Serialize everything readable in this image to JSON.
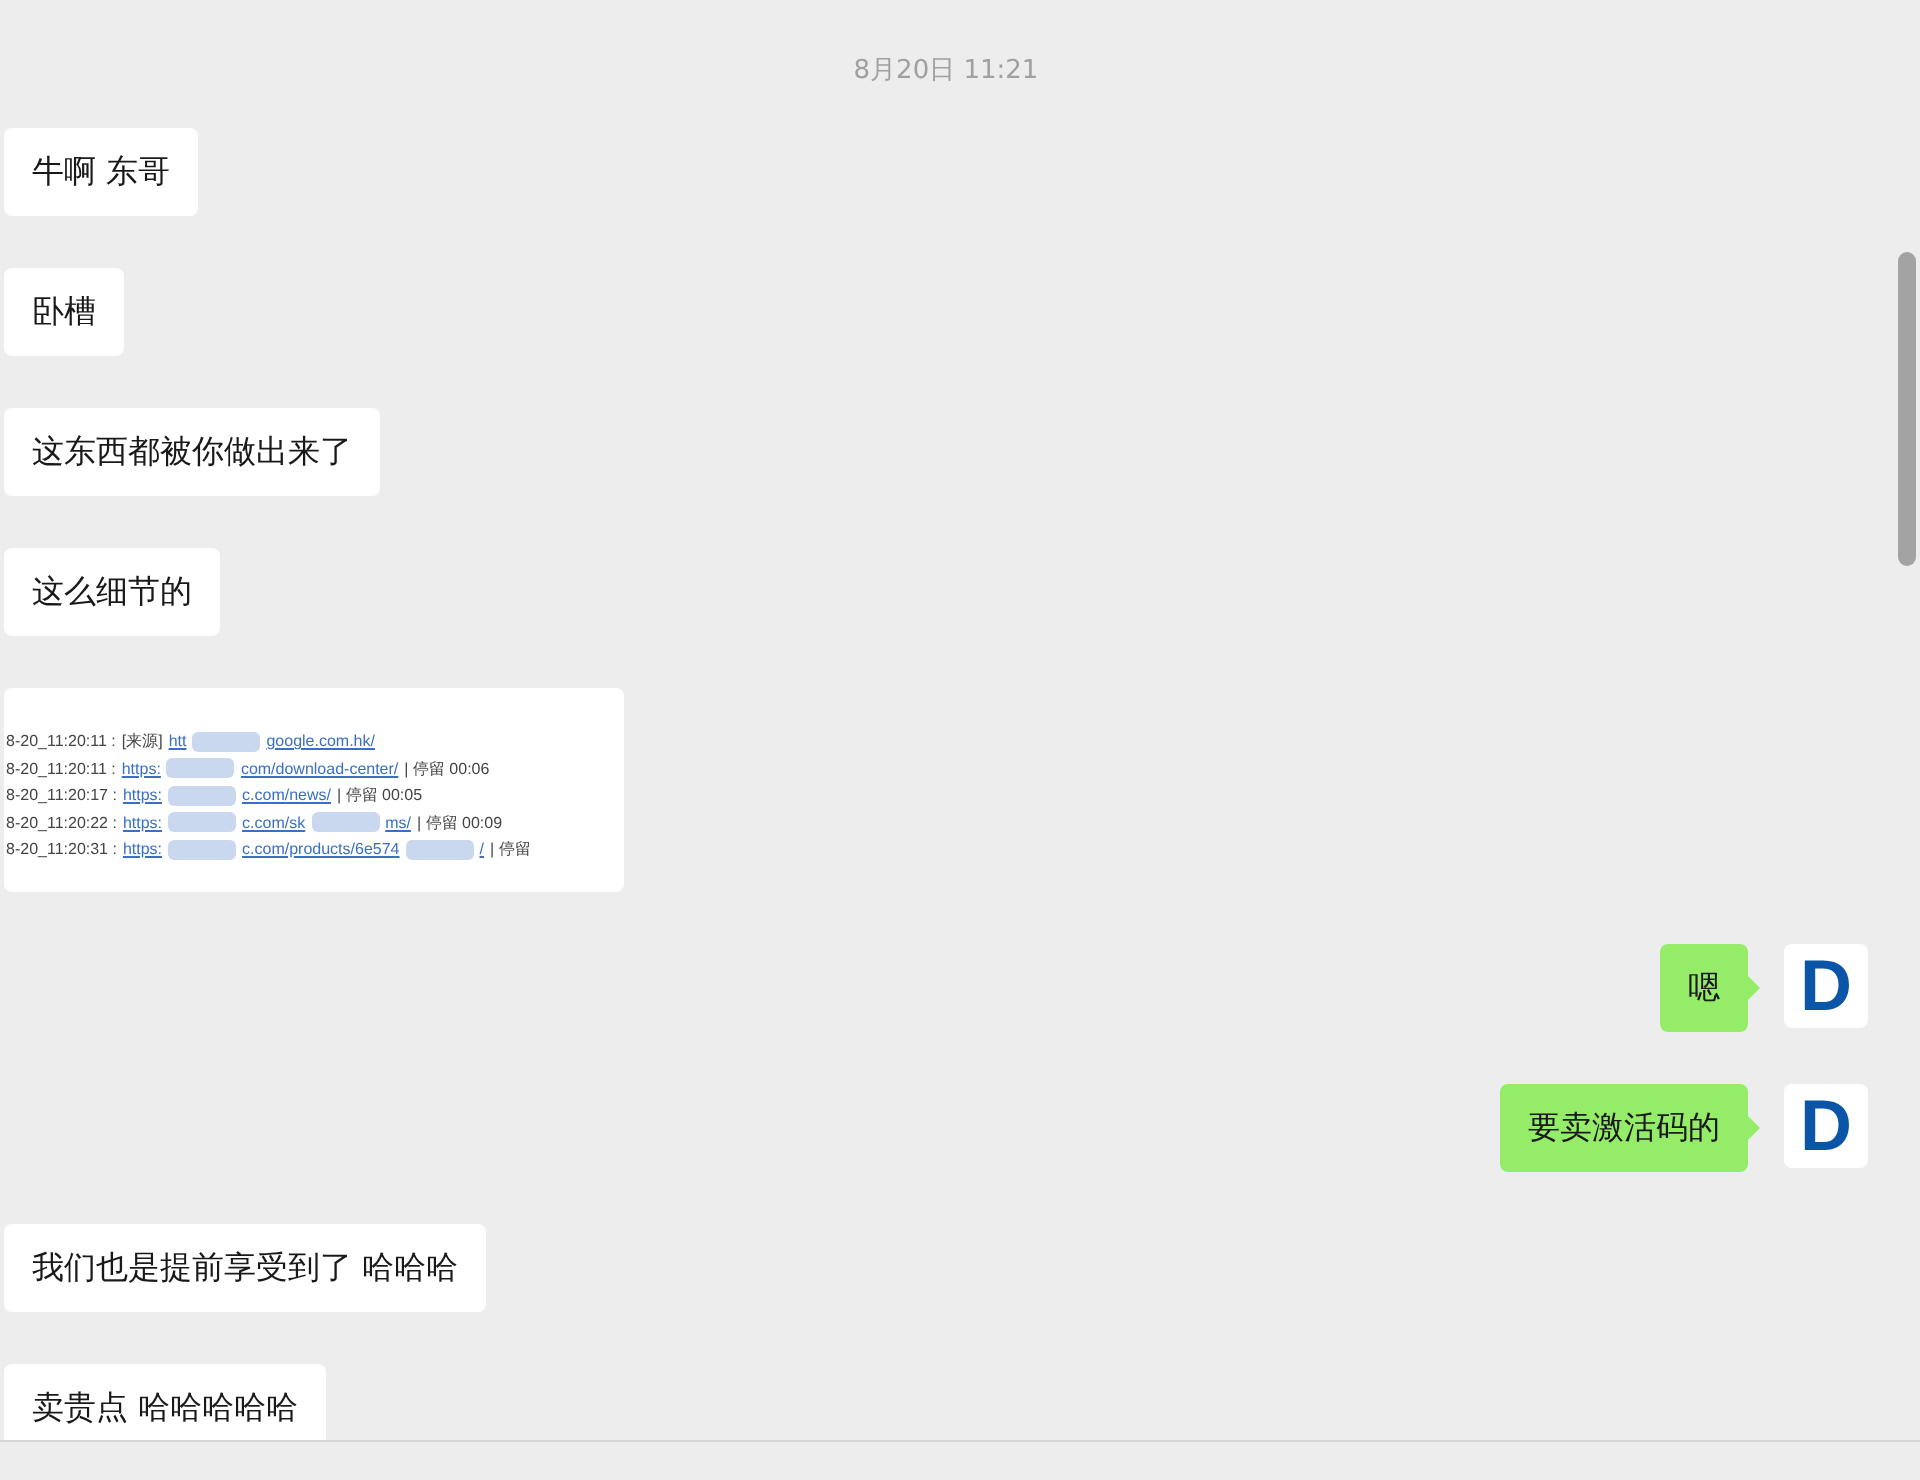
{
  "timestamp": "8月20日 11:21",
  "messages": [
    {
      "kind": "text",
      "outgoing": false,
      "text": "牛啊 东哥"
    },
    {
      "kind": "text",
      "outgoing": false,
      "text": "卧槽"
    },
    {
      "kind": "text",
      "outgoing": false,
      "text": "这东西都被你做出来了"
    },
    {
      "kind": "text",
      "outgoing": false,
      "text": "这么细节的"
    },
    {
      "kind": "image",
      "outgoing": false,
      "lines": [
        {
          "time": "8-20_11:20:11 :",
          "tag": "[来源]",
          "link_parts": [
            "htt",
            "google.com.hk/"
          ]
        },
        {
          "time": "8-20_11:20:11 :",
          "link_parts": [
            "https:",
            "com/download-center/"
          ],
          "stay": "| 停留 00:06"
        },
        {
          "time": "8-20_11:20:17 :",
          "link_parts": [
            "https:",
            "c.com/news/"
          ],
          "stay": "| 停留 00:05"
        },
        {
          "time": "8-20_11:20:22 :",
          "link_parts": [
            "https:",
            "c.com/sk",
            "ms/"
          ],
          "stay": "| 停留 00:09"
        },
        {
          "time": "8-20_11:20:31 :",
          "link_parts": [
            "https:",
            "c.com/products/6e574",
            "/"
          ],
          "stay": "| 停留"
        }
      ]
    },
    {
      "kind": "text",
      "outgoing": true,
      "text": "嗯",
      "avatar": "D"
    },
    {
      "kind": "text",
      "outgoing": true,
      "text": "要卖激活码的",
      "avatar": "D"
    },
    {
      "kind": "text",
      "outgoing": false,
      "text": "我们也是提前享受到了 哈哈哈"
    },
    {
      "kind": "text",
      "outgoing": false,
      "text": "卖贵点 哈哈哈哈哈"
    }
  ]
}
